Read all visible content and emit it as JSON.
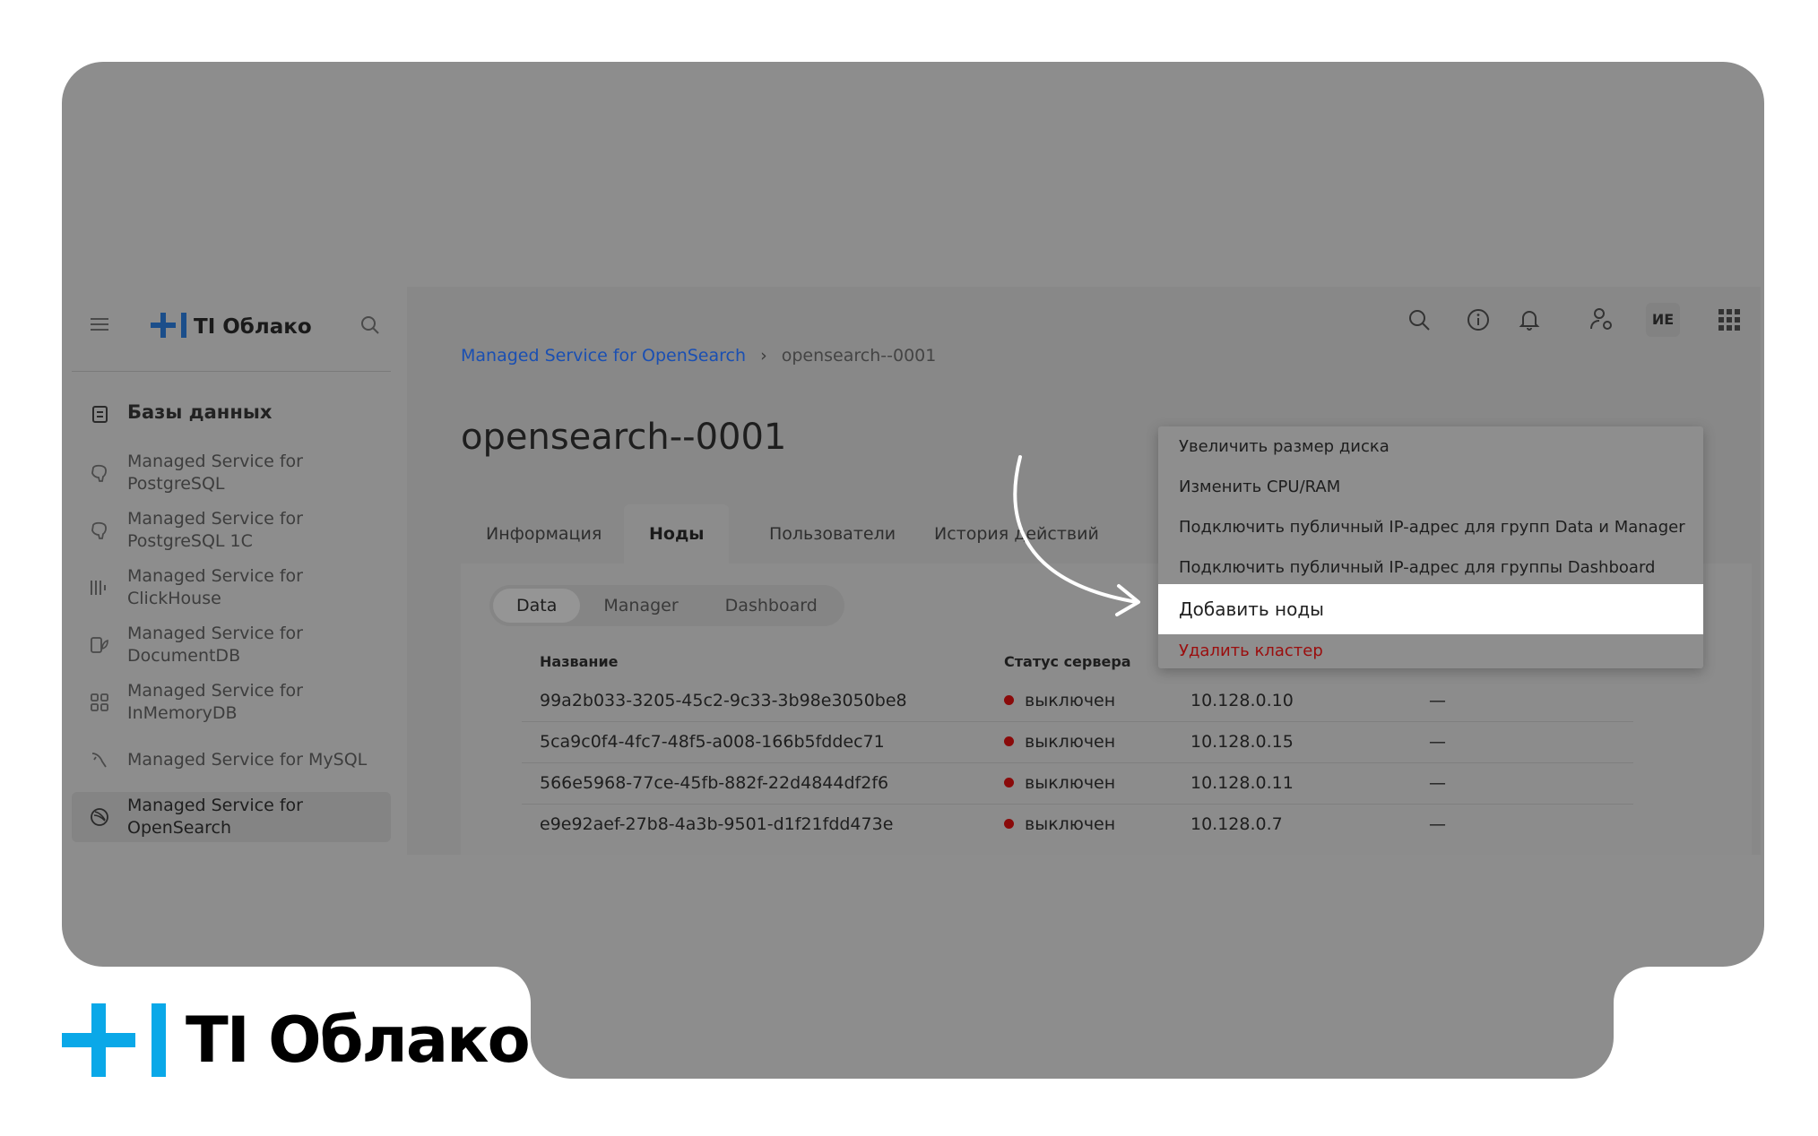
{
  "brand": {
    "name": "TI Облако",
    "logo_color": "#0aa8e8"
  },
  "sidebar": {
    "logo_text": "TI Облако",
    "section_title": "Базы данных",
    "items": [
      {
        "label": "Managed Service for\nPostgreSQL",
        "icon": "elephant-icon"
      },
      {
        "label": "Managed Service for\nPostgreSQL 1C",
        "icon": "elephant-icon"
      },
      {
        "label": "Managed Service for\nClickHouse",
        "icon": "bars-icon"
      },
      {
        "label": "Managed Service for\nDocumentDB",
        "icon": "leaf-doc-icon"
      },
      {
        "label": "Managed Service for\nInMemoryDB",
        "icon": "grid-icon"
      },
      {
        "label": "Managed Service for MySQL",
        "icon": "dolphin-icon"
      },
      {
        "label": "Managed Service for\nOpenSearch",
        "icon": "opensearch-icon",
        "active": true
      }
    ]
  },
  "header": {
    "avatar_initials": "ИЕ"
  },
  "breadcrumb": {
    "parent": "Managed Service for OpenSearch",
    "current": "opensearch--0001"
  },
  "page_title": "opensearch--0001",
  "tabs": [
    "Информация",
    "Ноды",
    "Пользователи",
    "История действий"
  ],
  "segments": [
    "Data",
    "Manager",
    "Dashboard"
  ],
  "table": {
    "headers": {
      "name": "Название",
      "status": "Статус сервера"
    },
    "rows": [
      {
        "name": "99a2b033-3205-45c2-9c33-3b98e3050be8",
        "status": "выключен",
        "ip": "10.128.0.10",
        "extra": "—"
      },
      {
        "name": "5ca9c0f4-4fc7-48f5-a008-166b5fddec71",
        "status": "выключен",
        "ip": "10.128.0.15",
        "extra": "—"
      },
      {
        "name": "566e5968-77ce-45fb-882f-22d4844df2f6",
        "status": "выключен",
        "ip": "10.128.0.11",
        "extra": "—"
      },
      {
        "name": "e9e92aef-27b8-4a3b-9501-d1f21fdd473e",
        "status": "выключен",
        "ip": "10.128.0.7",
        "extra": "—"
      }
    ]
  },
  "menu": {
    "items": [
      "Увеличить размер диска",
      "Изменить CPU/RAM",
      "Подключить публичный IP-адрес для групп Data и Manager",
      "Подключить публичный IP-адрес для группы Dashboard",
      "Добавить ноды",
      "Удалить кластер"
    ]
  }
}
